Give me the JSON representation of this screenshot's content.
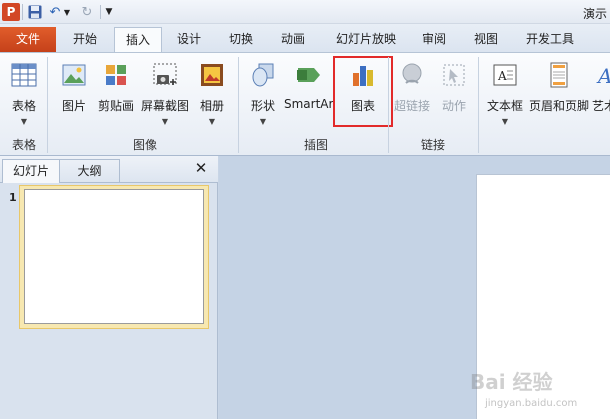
{
  "app": {
    "logo_text": "P",
    "window_title": "演示"
  },
  "tabs": [
    "文件",
    "开始",
    "插入",
    "设计",
    "切换",
    "动画",
    "幻灯片放映",
    "审阅",
    "视图",
    "开发工具"
  ],
  "ribbon": {
    "table": {
      "label": "表格",
      "group": "表格"
    },
    "image": {
      "picture": "图片",
      "clipart": "剪贴画",
      "screenshot": "屏幕截图",
      "album": "相册",
      "group": "图像"
    },
    "illustration": {
      "shapes": "形状",
      "smartart": "SmartArt",
      "chart": "图表",
      "group": "插图"
    },
    "links": {
      "hyperlink": "超链接",
      "action": "动作",
      "group": "链接"
    },
    "text": {
      "textbox": "文本框",
      "header_footer": "页眉和页脚",
      "wordart": "艺术"
    }
  },
  "panel": {
    "tab_slides": "幻灯片",
    "tab_outline": "大纲",
    "close": "✕",
    "slide_number": "1"
  },
  "watermark": {
    "main": "Bai 经验",
    "sub": "jingyan.baidu.com"
  },
  "colors": {
    "file_tab": "#d24726",
    "highlight": "#e22a2a",
    "ribbon_bg": "#f3f6fb"
  }
}
